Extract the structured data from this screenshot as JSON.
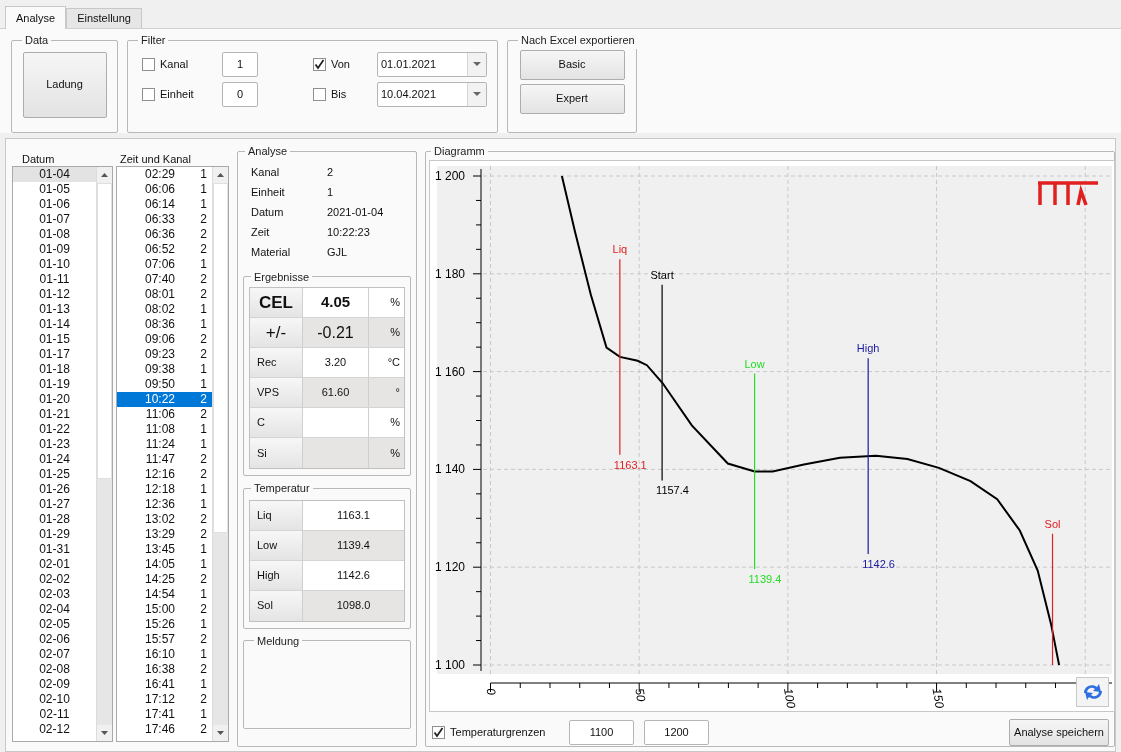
{
  "tabs": [
    {
      "label": "Analyse",
      "selected": true
    },
    {
      "label": "Einstellung",
      "selected": false
    }
  ],
  "data_group": {
    "title": "Data",
    "button": "Ladung"
  },
  "filter": {
    "title": "Filter",
    "rows": [
      {
        "check_label": "Kanal",
        "checked": false,
        "value": "1",
        "date_label": "Von",
        "date_checked": true,
        "date": "01.01.2021"
      },
      {
        "check_label": "Einheit",
        "checked": false,
        "value": "0",
        "date_label": "Bis",
        "date_checked": false,
        "date": "10.04.2021"
      }
    ]
  },
  "export": {
    "title": "Nach Excel exportieren",
    "buttons": [
      "Basic",
      "Expert"
    ]
  },
  "datum_list": {
    "header": "Datum",
    "items": [
      {
        "label": "01-04",
        "selected": true
      },
      {
        "label": "01-05",
        "selected": false
      },
      {
        "label": "01-06",
        "selected": false
      },
      {
        "label": "01-07",
        "selected": false
      },
      {
        "label": "01-08",
        "selected": false
      },
      {
        "label": "01-09",
        "selected": false
      },
      {
        "label": "01-10",
        "selected": false
      },
      {
        "label": "01-11",
        "selected": false
      },
      {
        "label": "01-12",
        "selected": false
      },
      {
        "label": "01-13",
        "selected": false
      },
      {
        "label": "01-14",
        "selected": false
      },
      {
        "label": "01-15",
        "selected": false
      },
      {
        "label": "01-17",
        "selected": false
      },
      {
        "label": "01-18",
        "selected": false
      },
      {
        "label": "01-19",
        "selected": false
      },
      {
        "label": "01-20",
        "selected": false
      },
      {
        "label": "01-21",
        "selected": false
      },
      {
        "label": "01-22",
        "selected": false
      },
      {
        "label": "01-23",
        "selected": false
      },
      {
        "label": "01-24",
        "selected": false
      },
      {
        "label": "01-25",
        "selected": false
      },
      {
        "label": "01-26",
        "selected": false
      },
      {
        "label": "01-27",
        "selected": false
      },
      {
        "label": "01-28",
        "selected": false
      },
      {
        "label": "01-29",
        "selected": false
      },
      {
        "label": "01-31",
        "selected": false
      },
      {
        "label": "02-01",
        "selected": false
      },
      {
        "label": "02-02",
        "selected": false
      },
      {
        "label": "02-03",
        "selected": false
      },
      {
        "label": "02-04",
        "selected": false
      },
      {
        "label": "02-05",
        "selected": false
      },
      {
        "label": "02-06",
        "selected": false
      },
      {
        "label": "02-07",
        "selected": false
      },
      {
        "label": "02-08",
        "selected": false
      },
      {
        "label": "02-09",
        "selected": false
      },
      {
        "label": "02-10",
        "selected": false
      },
      {
        "label": "02-11",
        "selected": false
      },
      {
        "label": "02-12",
        "selected": false
      }
    ]
  },
  "time_list": {
    "header": "Zeit und Kanal",
    "items": [
      {
        "time": "02:29",
        "kanal": "1",
        "selected": false
      },
      {
        "time": "06:06",
        "kanal": "1",
        "selected": false
      },
      {
        "time": "06:14",
        "kanal": "1",
        "selected": false
      },
      {
        "time": "06:33",
        "kanal": "2",
        "selected": false
      },
      {
        "time": "06:36",
        "kanal": "2",
        "selected": false
      },
      {
        "time": "06:52",
        "kanal": "2",
        "selected": false
      },
      {
        "time": "07:06",
        "kanal": "1",
        "selected": false
      },
      {
        "time": "07:40",
        "kanal": "2",
        "selected": false
      },
      {
        "time": "08:01",
        "kanal": "2",
        "selected": false
      },
      {
        "time": "08:02",
        "kanal": "1",
        "selected": false
      },
      {
        "time": "08:36",
        "kanal": "1",
        "selected": false
      },
      {
        "time": "09:06",
        "kanal": "2",
        "selected": false
      },
      {
        "time": "09:23",
        "kanal": "2",
        "selected": false
      },
      {
        "time": "09:38",
        "kanal": "1",
        "selected": false
      },
      {
        "time": "09:50",
        "kanal": "1",
        "selected": false
      },
      {
        "time": "10:22",
        "kanal": "2",
        "selected": true
      },
      {
        "time": "11:06",
        "kanal": "2",
        "selected": false
      },
      {
        "time": "11:08",
        "kanal": "1",
        "selected": false
      },
      {
        "time": "11:24",
        "kanal": "1",
        "selected": false
      },
      {
        "time": "11:47",
        "kanal": "2",
        "selected": false
      },
      {
        "time": "12:16",
        "kanal": "2",
        "selected": false
      },
      {
        "time": "12:18",
        "kanal": "1",
        "selected": false
      },
      {
        "time": "12:36",
        "kanal": "1",
        "selected": false
      },
      {
        "time": "13:02",
        "kanal": "2",
        "selected": false
      },
      {
        "time": "13:29",
        "kanal": "2",
        "selected": false
      },
      {
        "time": "13:45",
        "kanal": "1",
        "selected": false
      },
      {
        "time": "14:05",
        "kanal": "1",
        "selected": false
      },
      {
        "time": "14:25",
        "kanal": "2",
        "selected": false
      },
      {
        "time": "14:54",
        "kanal": "1",
        "selected": false
      },
      {
        "time": "15:00",
        "kanal": "2",
        "selected": false
      },
      {
        "time": "15:26",
        "kanal": "1",
        "selected": false
      },
      {
        "time": "15:57",
        "kanal": "2",
        "selected": false
      },
      {
        "time": "16:10",
        "kanal": "1",
        "selected": false
      },
      {
        "time": "16:38",
        "kanal": "2",
        "selected": false
      },
      {
        "time": "16:41",
        "kanal": "1",
        "selected": false
      },
      {
        "time": "17:12",
        "kanal": "2",
        "selected": false
      },
      {
        "time": "17:41",
        "kanal": "1",
        "selected": false
      },
      {
        "time": "17:46",
        "kanal": "2",
        "selected": false
      }
    ]
  },
  "analyse": {
    "title": "Analyse",
    "fields": [
      {
        "label": "Kanal",
        "value": "2"
      },
      {
        "label": "Einheit",
        "value": "1"
      },
      {
        "label": "Datum",
        "value": "2021-01-04"
      },
      {
        "label": "Zeit",
        "value": "10:22:23"
      },
      {
        "label": "Material",
        "value": "GJL"
      }
    ],
    "ergebnisse": {
      "title": "Ergebnisse",
      "rows": [
        {
          "kind": "bold",
          "label": "CEL",
          "value": "4.05",
          "unit": "%"
        },
        {
          "kind": "large",
          "label": "+/-",
          "value": "-0.21",
          "unit": "%"
        },
        {
          "kind": "normal",
          "label": "Rec",
          "value": "3.20",
          "unit": "°C"
        },
        {
          "kind": "normal",
          "label": "VPS",
          "value": "61.60",
          "unit": "°"
        },
        {
          "kind": "normal",
          "label": "C",
          "unit": "%"
        },
        {
          "kind": "normal",
          "label": "Si",
          "unit": "%"
        }
      ]
    },
    "temperatur": {
      "title": "Temperatur",
      "rows": [
        {
          "label": "Liq",
          "value": "1163.1"
        },
        {
          "label": "Low",
          "value": "1139.4"
        },
        {
          "label": "High",
          "value": "1142.6"
        },
        {
          "label": "Sol",
          "value": "1098.0"
        }
      ]
    },
    "meldung": {
      "title": "Meldung"
    }
  },
  "diagramm": {
    "title": "Diagramm",
    "chart_data": {
      "type": "line",
      "xlim": [
        -3.2,
        209
      ],
      "ylim": [
        1100,
        1200
      ],
      "grid": true,
      "xticks": [
        0,
        50,
        100,
        150
      ],
      "yticks": [
        {
          "value": 1100,
          "label": "1 100"
        },
        {
          "value": 1120,
          "label": "1 120"
        },
        {
          "value": 1140,
          "label": "1 140"
        },
        {
          "value": 1160,
          "label": "1 160"
        },
        {
          "value": 1180,
          "label": "1 180"
        },
        {
          "value": 1200,
          "label": "1 200"
        }
      ],
      "x": [
        24,
        28.4,
        33.7,
        39,
        43.5,
        49.5,
        52.6,
        57.9,
        67.7,
        79.8,
        88.8,
        94.9,
        105.4,
        117.5,
        129.6,
        140.2,
        150.8,
        161.4,
        170.4,
        178,
        184,
        188.5,
        191.2
      ],
      "series": [
        {
          "color": "#000000",
          "values": [
            1200,
            1188.6,
            1175.8,
            1164.9,
            1163,
            1162.2,
            1161.3,
            1157.6,
            1149,
            1141.2,
            1139.6,
            1139.6,
            1141,
            1142.4,
            1142.8,
            1142.1,
            1140.3,
            1137.6,
            1133.9,
            1127.5,
            1119.3,
            1108.4,
            1100
          ]
        }
      ],
      "ref_lines": [
        {
          "axis": "x",
          "value": 43.5,
          "label": "Liq",
          "color": "#e02020"
        },
        {
          "axis": "x",
          "value": 57.7,
          "label": "Start",
          "color": "#000000"
        },
        {
          "axis": "x",
          "value": 88.8,
          "label": "Low",
          "color": "#22dd22"
        },
        {
          "axis": "x",
          "value": 127,
          "label": "High",
          "color": "#1a1aa0"
        },
        {
          "axis": "x",
          "value": 189,
          "label": "Sol",
          "color": "#e02020"
        }
      ],
      "annotations": [
        "1163.1",
        "1157.4",
        "1139.4",
        "1142.6"
      ]
    },
    "limits": {
      "label": "Temperaturgrenzen",
      "checked": true,
      "min": "1100",
      "max": "1200"
    },
    "save_button": "Analyse speichern"
  }
}
